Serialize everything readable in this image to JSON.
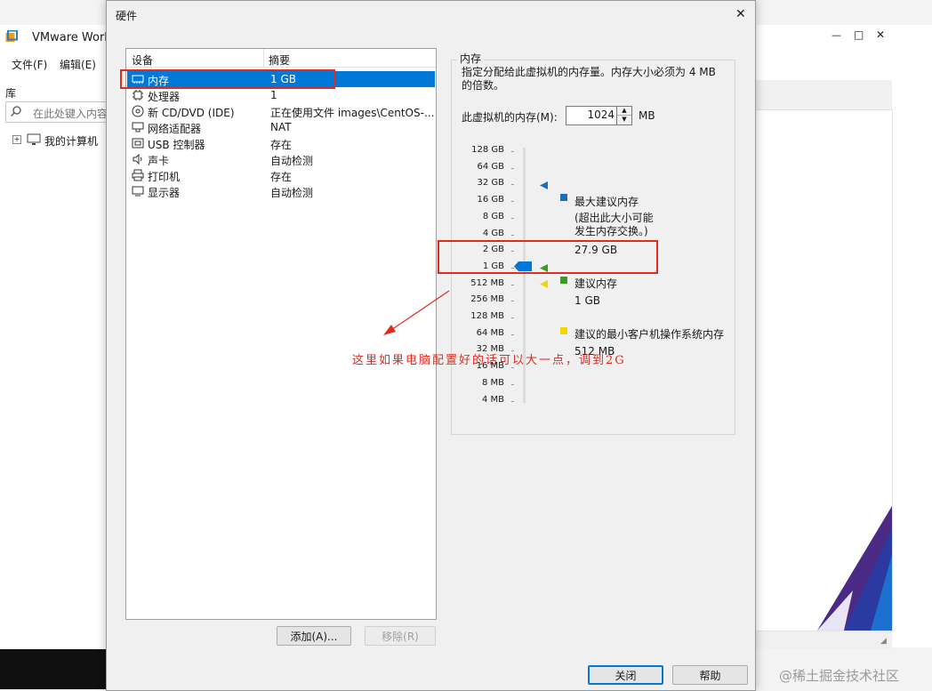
{
  "background_app": {
    "title": "VMware Work",
    "menu": [
      "文件(F)",
      "编辑(E)"
    ],
    "library_label": "库",
    "search_placeholder": "在此处键入内容",
    "tree_item": "我的计算机",
    "window_controls": [
      "—",
      "□",
      "✕"
    ]
  },
  "dialog": {
    "title": "硬件",
    "close_glyph": "✕",
    "device_table": {
      "headers": [
        "设备",
        "摘要"
      ],
      "rows": [
        {
          "icon": "memory-icon",
          "name": "内存",
          "summary": "1 GB",
          "selected": true
        },
        {
          "icon": "cpu-icon",
          "name": "处理器",
          "summary": "1",
          "selected": false
        },
        {
          "icon": "cd-dvd-icon",
          "name": "新 CD/DVD (IDE)",
          "summary": "正在使用文件 images\\CentOS-...",
          "selected": false
        },
        {
          "icon": "network-adapter-icon",
          "name": "网络适配器",
          "summary": "NAT",
          "selected": false
        },
        {
          "icon": "usb-controller-icon",
          "name": "USB 控制器",
          "summary": "存在",
          "selected": false
        },
        {
          "icon": "sound-card-icon",
          "name": "声卡",
          "summary": "自动检测",
          "selected": false
        },
        {
          "icon": "printer-icon",
          "name": "打印机",
          "summary": "存在",
          "selected": false
        },
        {
          "icon": "display-icon",
          "name": "显示器",
          "summary": "自动检测",
          "selected": false
        }
      ]
    },
    "add_button": "添加(A)...",
    "remove_button": "移除(R)",
    "close_button": "关闭",
    "help_button": "帮助",
    "memory_panel": {
      "group_label": "内存",
      "description": "指定分配给此虚拟机的内存量。内存大小必须为 4 MB 的倍数。",
      "memory_label": "此虚拟机的内存(M):",
      "memory_value": "1024",
      "memory_unit": "MB",
      "scale_labels": [
        "128 GB",
        "64 GB",
        "32 GB",
        "16 GB",
        "8 GB",
        "4 GB",
        "2 GB",
        "1 GB",
        "512 MB",
        "256 MB",
        "128 MB",
        "64 MB",
        "32 MB",
        "16 MB",
        "8 MB",
        "4 MB"
      ],
      "legend": {
        "max_title": "最大建议内存",
        "max_note": "(超出此大小可能发生内存交换。)",
        "max_value": "27.9 GB",
        "recommended_title": "建议内存",
        "recommended_value": "1 GB",
        "min_title": "建议的最小客户机操作系统内存",
        "min_value": "512 MB"
      },
      "colors": {
        "max": "#1e6fb5",
        "recommended": "#3c9a25",
        "min": "#f2d600",
        "selection": "#0078d7"
      }
    }
  },
  "annotation": {
    "text": "这里如果电脑配置好的话可以大一点，调到2G",
    "color": "#e02b20"
  },
  "watermark": "@稀土掘金技术社区"
}
